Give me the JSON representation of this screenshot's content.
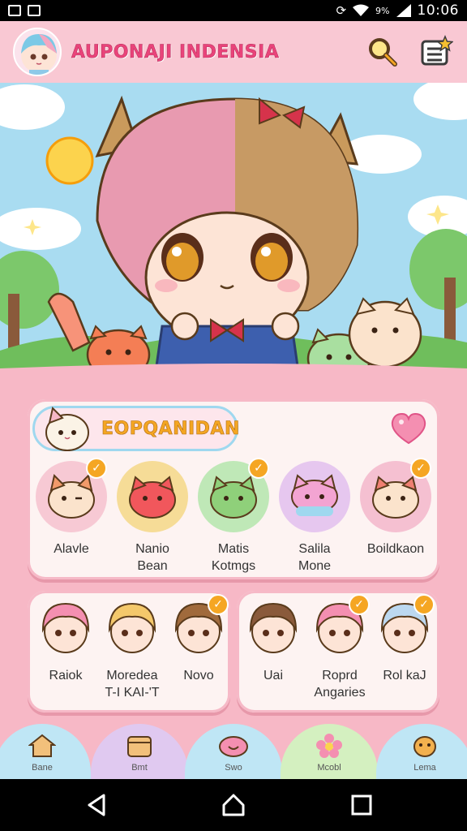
{
  "status_bar": {
    "battery": "9%",
    "time": "10:06"
  },
  "header": {
    "title": "AUPONAJI INDENSIA"
  },
  "section": {
    "title": "EOPQANIDAN"
  },
  "pets": [
    {
      "label": "Alavle",
      "color": "#f7c9d4"
    },
    {
      "label": "Nanio\nBean",
      "color": "#f6dc97"
    },
    {
      "label": "Matis\nKotmgs",
      "color": "#bfe8b7"
    },
    {
      "label": "Salila\nMone",
      "color": "#e6c7ef"
    },
    {
      "label": "Boildkaon",
      "color": "#f5c0d1"
    }
  ],
  "characters_left": [
    {
      "label": "Raiok"
    },
    {
      "label": "Moredea\nT-I KAI-'T"
    },
    {
      "label": "Novo"
    }
  ],
  "characters_right": [
    {
      "label": "Uai"
    },
    {
      "label": "Roprd\nAngaries"
    },
    {
      "label": "Rol kaJ"
    }
  ],
  "nav": [
    {
      "label": "Bane",
      "color": "#bfe6f5"
    },
    {
      "label": "Bmt",
      "color": "#e0c9f0"
    },
    {
      "label": "Swo",
      "color": "#bfe6f5"
    },
    {
      "label": "Mcobl",
      "color": "#d4f0c0"
    },
    {
      "label": "Lema",
      "color": "#bfe6f5"
    }
  ]
}
